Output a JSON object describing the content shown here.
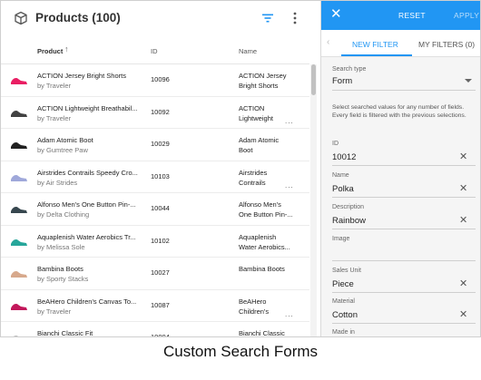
{
  "header": {
    "title": "Products (100)"
  },
  "columns": {
    "product": "Product",
    "sort_glyph": "↑",
    "id": "ID",
    "name": "Name"
  },
  "rows": [
    {
      "name": "ACTION Jersey Bright Shorts",
      "by": "by Traveler",
      "id": "10096",
      "n1": "ACTION Jersey",
      "n2": "Bright Shorts",
      "more": "",
      "thumb": "#e91e63",
      "icon": "shorts-icon"
    },
    {
      "name": "ACTION Lightweight Breathabil...",
      "by": "by Traveler",
      "id": "10092",
      "n1": "ACTION",
      "n2": "Lightweight",
      "more": "...",
      "thumb": "#424242",
      "icon": "shoe-icon"
    },
    {
      "name": "Adam Atomic Boot",
      "by": "by Gumtree Paw",
      "id": "10029",
      "n1": "Adam Atomic",
      "n2": "Boot",
      "more": "",
      "thumb": "#212121",
      "icon": "boot-icon"
    },
    {
      "name": "Airstrides Contrails Speedy Cro...",
      "by": "by Air Strides",
      "id": "10103",
      "n1": "Airstrides",
      "n2": "Contrails",
      "more": "...",
      "thumb": "#9fa8da",
      "icon": "shoe-icon"
    },
    {
      "name": "Alfonso Men's One Button Pin-...",
      "by": "by Delta Clothing",
      "id": "10044",
      "n1": "Alfonso Men's",
      "n2": "One Button Pin-...",
      "more": "",
      "thumb": "#37474f",
      "icon": "jacket-icon"
    },
    {
      "name": "Aquaplenish Water Aerobics Tr...",
      "by": "by Melissa Sole",
      "id": "10102",
      "n1": "Aquaplenish",
      "n2": "Water Aerobics...",
      "more": "",
      "thumb": "#26a69a",
      "icon": "shoe-icon"
    },
    {
      "name": "Bambina Boots",
      "by": "by Sporty Stacks",
      "id": "10027",
      "n1": "Bambina Boots",
      "n2": "",
      "more": "",
      "thumb": "#d7a98c",
      "icon": "boot-icon"
    },
    {
      "name": "BeAHero Children's Canvas To...",
      "by": "by Traveler",
      "id": "10087",
      "n1": "BeAHero",
      "n2": "Children's",
      "more": "...",
      "thumb": "#c2185b",
      "icon": "shoe-icon"
    },
    {
      "name": "Bianchi Classic Fit",
      "by": "",
      "id": "10004",
      "n1": "Bianchi Classic",
      "n2": "",
      "more": "",
      "thumb": "#bdbdbd",
      "icon": "shirt-icon"
    }
  ],
  "filter_panel": {
    "reset": "RESET",
    "apply": "APPLY",
    "tab_new": "NEW FILTER",
    "tab_mine": "MY FILTERS (0)",
    "search_type_label": "Search type",
    "search_type_value": "Form",
    "help": "Select searched values for any number of fields. Every field is filtered with the previous selections.",
    "fields": [
      {
        "label": "ID",
        "value": "10012"
      },
      {
        "label": "Name",
        "value": "Polka"
      },
      {
        "label": "Description",
        "value": "Rainbow"
      },
      {
        "label": "Image",
        "value": ""
      },
      {
        "label": "Sales Unit",
        "value": "Piece"
      },
      {
        "label": "Material",
        "value": "Cotton"
      },
      {
        "label": "Made in",
        "value": ""
      }
    ]
  },
  "caption": "Custom Search Forms",
  "colors": {
    "accent": "#2196f3"
  }
}
